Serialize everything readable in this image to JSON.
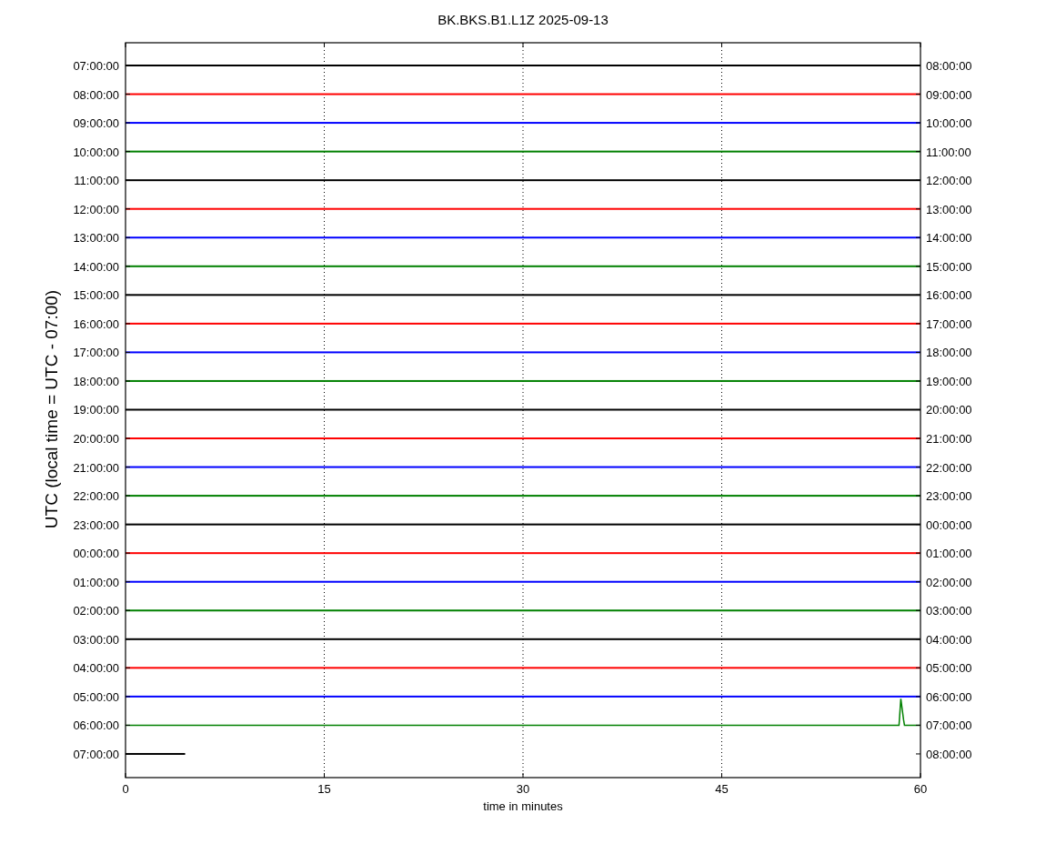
{
  "title": "BK.BKS.B1.L1Z 2025-09-13",
  "ylabel": "UTC (local time = UTC - 07:00)",
  "xlabel": "time in minutes",
  "xticks": [
    "0",
    "15",
    "30",
    "45",
    "60"
  ],
  "traces": [
    {
      "left": "07:00:00",
      "right": "08:00:00",
      "color": "#000000",
      "kind": "quiet",
      "level": 1
    },
    {
      "left": "08:00:00",
      "right": "09:00:00",
      "color": "#ff0000",
      "kind": "quiet",
      "level": 1
    },
    {
      "left": "09:00:00",
      "right": "10:00:00",
      "color": "#0000ff",
      "kind": "quiet",
      "level": 1
    },
    {
      "left": "10:00:00",
      "right": "11:00:00",
      "color": "#008000",
      "kind": "quiet",
      "level": 1
    },
    {
      "left": "11:00:00",
      "right": "12:00:00",
      "color": "#000000",
      "kind": "quiet",
      "level": 1
    },
    {
      "left": "12:00:00",
      "right": "13:00:00",
      "color": "#ff0000",
      "kind": "quiet",
      "level": 1
    },
    {
      "left": "13:00:00",
      "right": "14:00:00",
      "color": "#0000ff",
      "kind": "quiet",
      "level": 1
    },
    {
      "left": "14:00:00",
      "right": "15:00:00",
      "color": "#008000",
      "kind": "quiet",
      "level": 1
    },
    {
      "left": "15:00:00",
      "right": "16:00:00",
      "color": "#000000",
      "kind": "quiet",
      "level": 1
    },
    {
      "left": "16:00:00",
      "right": "17:00:00",
      "color": "#ff0000",
      "kind": "quiet",
      "level": 1
    },
    {
      "left": "17:00:00",
      "right": "18:00:00",
      "color": "#0000ff",
      "kind": "quiet",
      "level": 1
    },
    {
      "left": "18:00:00",
      "right": "19:00:00",
      "color": "#008000",
      "kind": "quiet",
      "level": 1
    },
    {
      "left": "19:00:00",
      "right": "20:00:00",
      "color": "#000000",
      "kind": "quiet",
      "level": 1
    },
    {
      "left": "20:00:00",
      "right": "21:00:00",
      "color": "#ff0000",
      "kind": "quiet",
      "level": 1
    },
    {
      "left": "21:00:00",
      "right": "22:00:00",
      "color": "#0000ff",
      "kind": "quiet",
      "level": 1
    },
    {
      "left": "22:00:00",
      "right": "23:00:00",
      "color": "#008000",
      "kind": "quiet",
      "level": 1
    },
    {
      "left": "23:00:00",
      "right": "00:00:00",
      "color": "#000000",
      "kind": "quiet",
      "level": 1
    },
    {
      "left": "00:00:00",
      "right": "01:00:00",
      "color": "#ff0000",
      "kind": "quiet",
      "level": 1
    },
    {
      "left": "01:00:00",
      "right": "02:00:00",
      "color": "#0000ff",
      "kind": "quiet",
      "level": 1
    },
    {
      "left": "02:00:00",
      "right": "03:00:00",
      "color": "#008000",
      "kind": "quiet",
      "level": 1
    },
    {
      "left": "03:00:00",
      "right": "04:00:00",
      "color": "#000000",
      "kind": "quiet",
      "level": 1
    },
    {
      "left": "04:00:00",
      "right": "05:00:00",
      "color": "#ff0000",
      "kind": "quiet",
      "level": 1
    },
    {
      "left": "05:00:00",
      "right": "06:00:00",
      "color": "#0000ff",
      "kind": "quiet",
      "level": 1
    },
    {
      "left": "06:00:00",
      "right": "07:00:00",
      "color": "#008000",
      "kind": "spike",
      "level": 1
    },
    {
      "left": "07:00:00",
      "right": "08:00:00",
      "color": "#000000",
      "kind": "quiet",
      "level": 0.075
    }
  ]
}
